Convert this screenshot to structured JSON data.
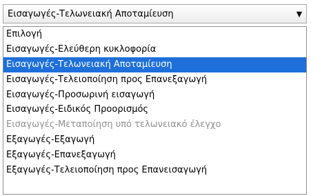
{
  "select": {
    "value": "Εισαγωγές-Τελωνειακή Αποταμίευση",
    "arrow_icon": "triangle-down-icon"
  },
  "options": [
    {
      "label": "Επιλογή",
      "state": "normal"
    },
    {
      "label": "Εισαγωγές-Ελεύθερη κυκλοφορία",
      "state": "normal"
    },
    {
      "label": "Εισαγωγές-Τελωνειακή Αποταμίευση",
      "state": "selected"
    },
    {
      "label": "Εισαγωγές-Τελειοποίηση προς Επανεξαγωγή",
      "state": "normal"
    },
    {
      "label": "Εισαγωγές-Προσωρινή εισαγωγή",
      "state": "normal"
    },
    {
      "label": "Εισαγωγές-Ειδικός Προορισμός",
      "state": "normal"
    },
    {
      "label": "Εισαγωγές-Μεταποίηση υπό τελωνειακό έλεγχο",
      "state": "disabled"
    },
    {
      "label": "Εξαγωγές-Εξαγωγή",
      "state": "normal"
    },
    {
      "label": "Εξαγωγές-Επανεξαγωγή",
      "state": "normal"
    },
    {
      "label": "Εξαγωγές-Τελειοποίηση προς Επανεισαγωγή",
      "state": "normal"
    }
  ],
  "colors": {
    "selected_background": "#1e6fd9",
    "disabled_text": "#8f8f8f"
  }
}
